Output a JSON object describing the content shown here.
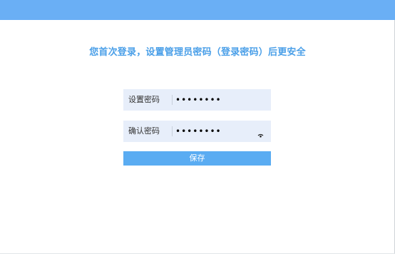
{
  "header": {
    "color": "#6aaff5"
  },
  "headline": {
    "text": "您首次登录，设置管理员密码（登录密码）后更安全",
    "color": "#4a9fe8"
  },
  "form": {
    "set_password": {
      "label": "设置密码",
      "value": "••••••••"
    },
    "confirm_password": {
      "label": "确认密码",
      "value": "••••••••",
      "icon": "eye-icon"
    },
    "save_button": {
      "label": "保存",
      "color": "#5aacf2"
    }
  }
}
